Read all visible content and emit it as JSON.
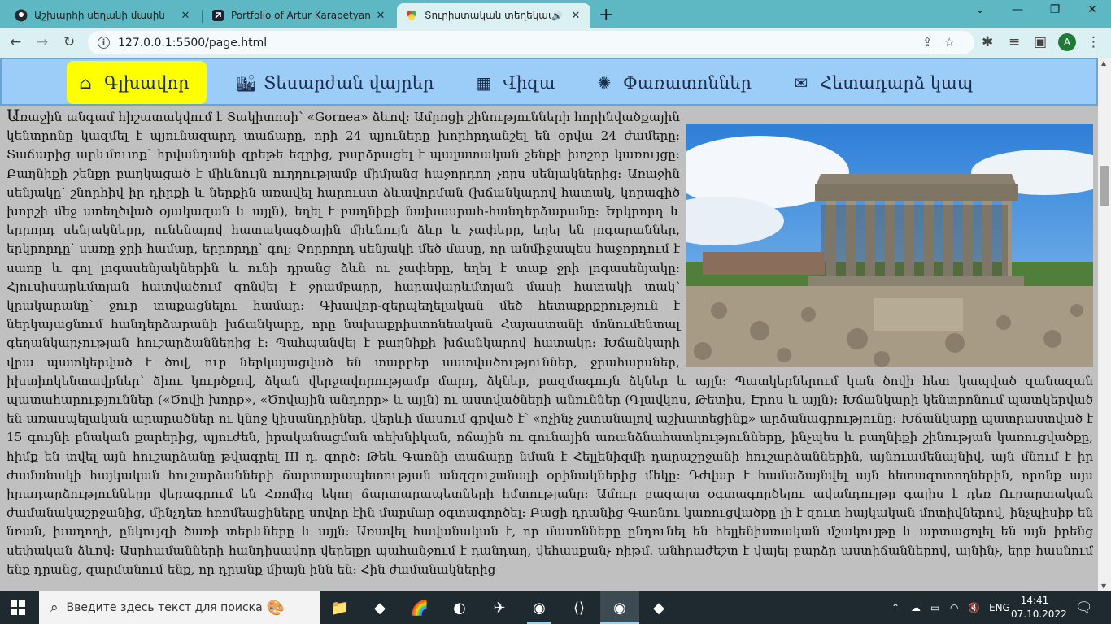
{
  "browser": {
    "tabs": [
      {
        "title": "Աշխարհի սեղանի մասին",
        "favicon": "github-icon",
        "active": false
      },
      {
        "title": "Portfolio of Artur Karapetyan",
        "favicon": "codepen-icon",
        "active": false
      },
      {
        "title": "Տուրիստական տեղեկատու",
        "favicon": "site-icon",
        "active": true,
        "audio": true
      }
    ],
    "new_tab_symbol": "+",
    "address": "127.0.0.1:5500/page.html",
    "profile_initial": "A"
  },
  "nav": {
    "items": [
      {
        "label": "Գլխավոր",
        "icon": "⌂",
        "active": true
      },
      {
        "label": "Տեսարժան վայրեր",
        "icon": "🏙",
        "active": false
      },
      {
        "label": "Վիզա",
        "icon": "▦",
        "active": false
      },
      {
        "label": "Փառատոններ",
        "icon": "✺",
        "active": false
      },
      {
        "label": "Հետադարձ կապ",
        "icon": "✉",
        "active": false
      }
    ]
  },
  "article": {
    "image_alt": "Գառնիի տաճար",
    "text": "Առաջին անգամ հիշատակվում է Տակիտոսի՝ «Gornea» ձևով: Ամրոցի շինությունների հորինվածքային կենտրոնը կազմել է պյունազարդ տաճարը, որի 24 պյուները խորհրդանշել են օրվա 24 ժամերը: Տաճարից արևմուտք՝ հրվանդանի զրեթե եզրից, բարձրացել է պալատական շենքի խոշոր կառույցը: Բաղնիքի շենքը բաղկացած է միևնույն ուղղությամբ միմյանց հաջորդող չորս սենյակներից: Առաջին սենյակը՝ շնորհիվ իր դիրքի և ներքին առավել հարուստ ձևավորման (խճանկարով հատակ, կորագիծ խորշի մեջ ստեղծված օյակազան և այլն), եղել է բաղնիքի նախասրահ-հանդերձարանը: Երկրորդ և երրորդ սենյակները, ունենալով հատակագծային միևնույն ձևը և չափերը, եղել են լոգարաններ, երկրորդը՝ սառը ջրի համար, երրորդը՝ գոլ: Չորրորդ սենյակի մեծ մասը, որ անմիջապես հաջորդում է սառը և գոլ լոգասենյակներին և ունի դրանց ձևն ու չափերը, եղել է տաք ջրի լոգասենյակը: Հյուսիսարևմտյան հատվածում զոնվել է ջրամբարը, հարավարևմտյան մասի հատակի տակ՝ կրակարանը՝ ջուր տաքացնելու համար: Գխավոր-զերպեղելական մեծ հետաքրքրություն է ներկայացնում հանդերձարանի խճանկարը, որը նախաքրիստոնեական Հայաստանի մոնումենտալ գեղանկարչության հուշարձաններից է: Պահպանվել է բաղնիքի խճանկարով հատակը: Խճանկարի վրա պատկերված է ծով, ուր ներկայացված են տարբեր աստվածություններ, ջրահարսներ, իխտիոկենտավրներ՝ ձիու կուրծքով, ձկան վերջավորությամբ մարդ, ձկներ, բազմագույն ձկներ և այլն: Պատկերներում կան ծովի հետ կապված զանազան պատահարություններ («Ծովի խորք», «Ծովային անդորր» և այլն) ու աստվածների անուններ (Գլավկոս, Թետիս, Էրոս և այլն): Խճանկարի կենտրոնում պատկերված են առասպելական արարածներ ու կնոջ կիսանդրիներ, վերևի մասում գրված է՝ «ոչինչ չստանալով աշխատեցինք» արձանագրությունը: Խճանկարը պատրաստված է 15 գույնի բնական քարերից, պյուժեն, իրականացման տեխնիկան, ոճային ու գունային առանձնահատկությունները, ինչպես և բաղնիքի շինության կառուցվածքը, հիմք են տվել այն հուշարձանը թվագրել III դ. գործ: Թեև Գառնի տաճարը նման է Հելլենիզմի դարաշրջանի հուշարձաններին, այնուամենայնիվ, այն մնում է իր ժամանակի հայկական հուշարձանների ճարտարապետության անզգուշանալի օրինակներից մեկը: Դժվար է համաձայնվել այն հետազոտողներին, որոնք այս իրադարձությունները վերագրում են Հռոմից եկող ճարտարապետների հմտությանը: Ամուր բազալտ օգտագործելու ավանդույթը գալիս է դեռ Ուրարտական ժամանակաշրջանից, մինչդեռ հռոմեացիները սովոր էին մարմար օգտագործել: Բացի դրանից Գառնու կառուցվածքը լի է զուտ հայկական մոտիվներով, ինչպիսիք են նռան, խաղողի, ընկույզի ծառի տերևները և այլն: Առավել հավանական է, որ մասոնները ընդունել են հելլենիստական մշակույթը և արտացոլել են այն իրենց սեփական ձևով: Ասրհամանների հանդիսավոր վերելքը պահանջում է դանդաղ, վեհասքանչ ռիթմ. անհրաժեշտ է վայել բարձր աստիճաններով, այնինչ, երբ հասնում ենք դրանց, զարմանում ենք, որ դրանք միայն ինն են: Հին ժամանակներից"
  },
  "taskbar": {
    "search_placeholder": "Введите здесь текст для поиска",
    "language": "ENG",
    "time": "14:41",
    "date": "07.10.2022"
  },
  "colors": {
    "tab_strip": "#5db8c4",
    "toolbar": "#dbf0f3",
    "nav_background": "#9ccdf8",
    "nav_active": "#ffff00",
    "page_background": "#c0c0c0",
    "taskbar": "#1f2a30"
  }
}
